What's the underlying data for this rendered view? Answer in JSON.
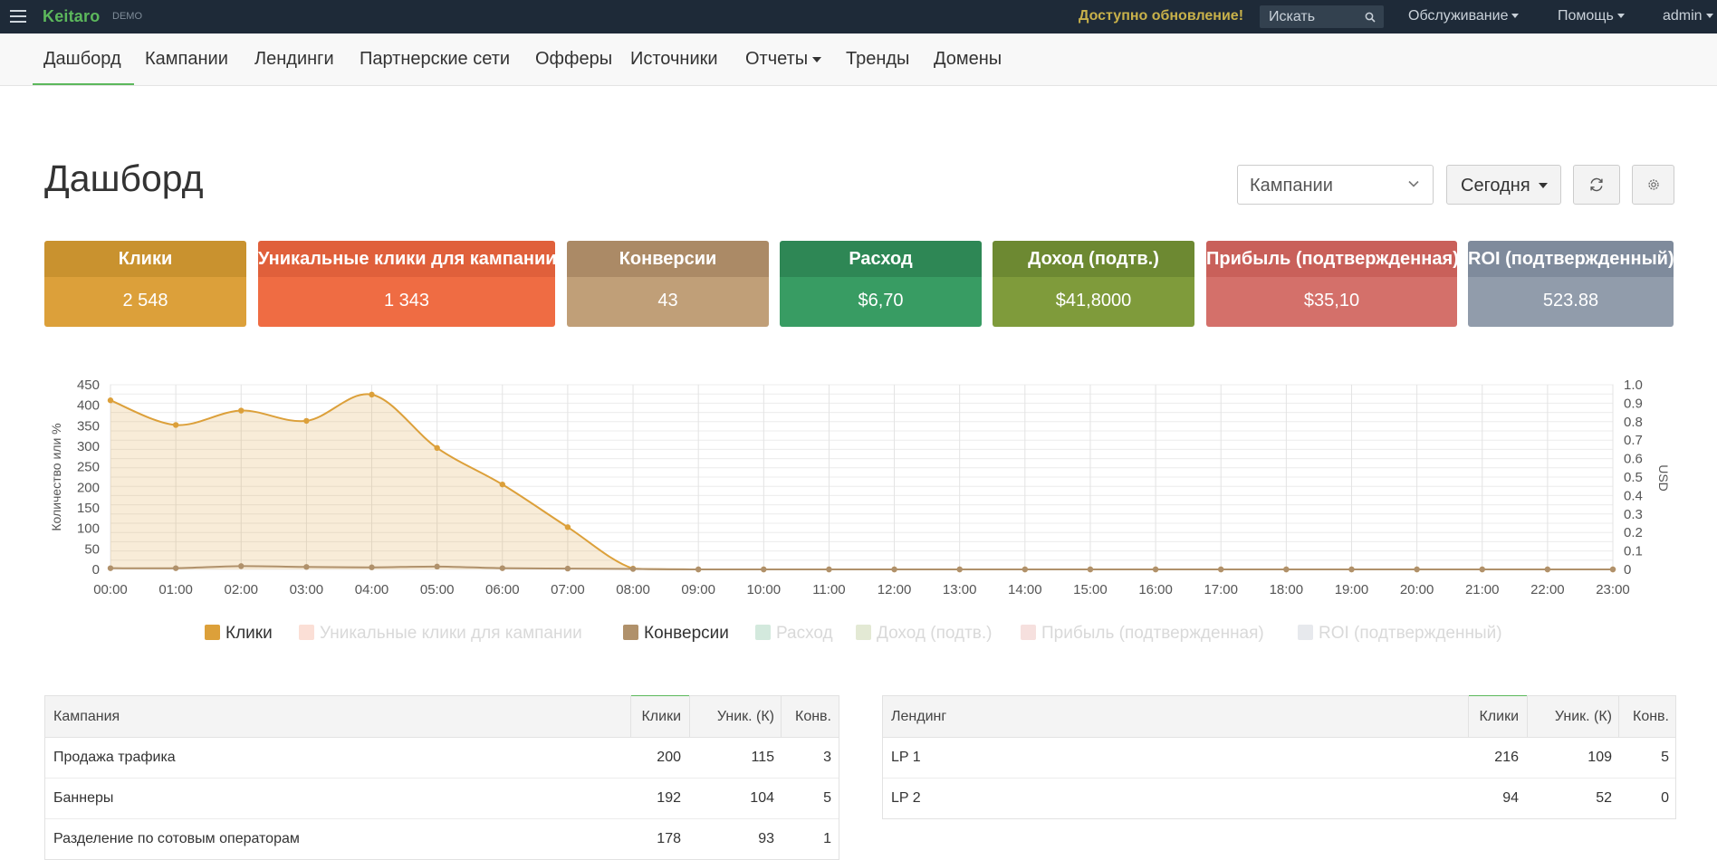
{
  "app": {
    "brand": "Keitaro",
    "badge": "DEMO",
    "update_notice": "Доступно обновление!",
    "search_placeholder": "Искать",
    "menu_service": "Обслуживание",
    "menu_help": "Помощь",
    "menu_user": "admin"
  },
  "nav": {
    "items": [
      "Дашборд",
      "Кампании",
      "Лендинги",
      "Партнерские сети",
      "Офферы",
      "Источники",
      "Отчеты",
      "Тренды",
      "Домены"
    ],
    "active": "Дашборд"
  },
  "page": {
    "title": "Дашборд",
    "group_select": "Кампании",
    "date_button": "Сегодня"
  },
  "cards": [
    {
      "label": "Клики",
      "value": "2 548",
      "head": "#c9922f",
      "body": "#dca03a"
    },
    {
      "label": "Уникальные клики для кампании",
      "value": "1 343",
      "head": "#e0603b",
      "body": "#ef6c43"
    },
    {
      "label": "Конверсии",
      "value": "43",
      "head": "#ab8a66",
      "body": "#c09f78"
    },
    {
      "label": "Расход",
      "value": "$6,70",
      "head": "#2e8755",
      "body": "#389c63"
    },
    {
      "label": "Доход (подтв.)",
      "value": "$41,8000",
      "head": "#6d8932",
      "body": "#7f9b3b"
    },
    {
      "label": "Прибыль (подтвержденная)",
      "value": "$35,10",
      "head": "#c9605a",
      "body": "#d4706a"
    },
    {
      "label": "ROI (подтвержденный)",
      "value": "523.88",
      "head": "#7f8b9c",
      "body": "#919cab"
    }
  ],
  "chart_data": {
    "type": "area",
    "ylabel": "Количество или %",
    "y2label": "USD",
    "ylim": [
      0,
      450
    ],
    "y2lim": [
      0,
      1.0
    ],
    "yticks": [
      0,
      50,
      100,
      150,
      200,
      250,
      300,
      350,
      400,
      450
    ],
    "y2ticks": [
      "0",
      "0.1",
      "0.2",
      "0.3",
      "0.4",
      "0.5",
      "0.6",
      "0.7",
      "0.8",
      "0.9",
      "1.0"
    ],
    "x": [
      "00:00",
      "01:00",
      "02:00",
      "03:00",
      "04:00",
      "05:00",
      "06:00",
      "07:00",
      "08:00",
      "09:00",
      "10:00",
      "11:00",
      "12:00",
      "13:00",
      "14:00",
      "15:00",
      "16:00",
      "17:00",
      "18:00",
      "19:00",
      "20:00",
      "21:00",
      "22:00",
      "23:00"
    ],
    "series": [
      {
        "name": "Клики",
        "values": [
          412,
          352,
          387,
          362,
          426,
          296,
          207,
          103,
          2,
          0,
          0,
          0,
          0,
          0,
          0,
          0,
          0,
          0,
          0,
          0,
          0,
          0,
          0,
          0
        ],
        "color": "#dca03a"
      },
      {
        "name": "Конверсии",
        "values": [
          3,
          3,
          8,
          6,
          5,
          7,
          3,
          2,
          1,
          0,
          0,
          0,
          0,
          0,
          0,
          0,
          0,
          0,
          0,
          0,
          0,
          0,
          0,
          0
        ],
        "color": "#b0916b"
      }
    ],
    "legend": [
      {
        "name": "Клики",
        "color": "#dca03a",
        "active": true
      },
      {
        "name": "Уникальные клики для кампании",
        "color": "#ef6c43",
        "active": false
      },
      {
        "name": "Конверсии",
        "color": "#b0916b",
        "active": true
      },
      {
        "name": "Расход",
        "color": "#389c63",
        "active": false
      },
      {
        "name": "Доход (подтв.)",
        "color": "#7f9b3b",
        "active": false
      },
      {
        "name": "Прибыль (подтвержденная)",
        "color": "#d4706a",
        "active": false
      },
      {
        "name": "ROI (подтвержденный)",
        "color": "#919cab",
        "active": false
      }
    ],
    "grid": true,
    "legend_position": "bottom"
  },
  "tables": {
    "campaigns": {
      "headers": [
        "Кампания",
        "Клики",
        "Уник. (К)",
        "Конв."
      ],
      "rows": [
        [
          "Продажа трафика",
          "200",
          "115",
          "3"
        ],
        [
          "Баннеры",
          "192",
          "104",
          "5"
        ],
        [
          "Разделение по сотовым операторам",
          "178",
          "93",
          "1"
        ]
      ]
    },
    "landings": {
      "headers": [
        "Лендинг",
        "Клики",
        "Уник. (К)",
        "Конв."
      ],
      "rows": [
        [
          "LP 1",
          "216",
          "109",
          "5"
        ],
        [
          "LP 2",
          "94",
          "52",
          "0"
        ]
      ]
    }
  }
}
